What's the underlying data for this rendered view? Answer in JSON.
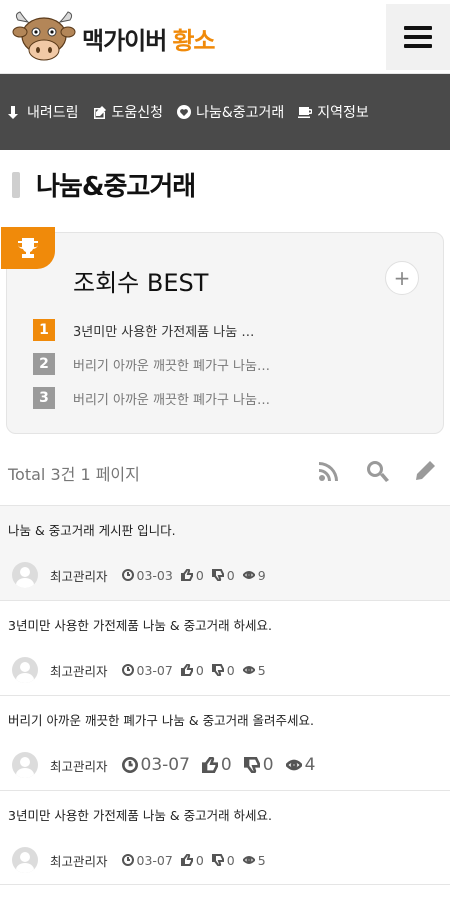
{
  "header": {
    "brand_dark": "맥가이버",
    "brand_orange": "황소"
  },
  "nav": {
    "items": [
      {
        "label": "내려드림",
        "icon": "download-arrow-icon"
      },
      {
        "label": "도움신청",
        "icon": "edit-icon"
      },
      {
        "label": "나눔&중고거래",
        "icon": "heart-icon"
      },
      {
        "label": "지역정보",
        "icon": "coffee-icon"
      }
    ]
  },
  "page": {
    "title": "나눔&중고거래"
  },
  "best": {
    "title": "조회수 BEST",
    "plus": "+",
    "items": [
      {
        "rank": "1",
        "text": "3년미만 사용한 가전제품 나눔 …"
      },
      {
        "rank": "2",
        "text": "버리기 아까운 깨끗한 폐가구 나눔…"
      },
      {
        "rank": "3",
        "text": "버리기 아까운 깨끗한 폐가구 나눔…"
      }
    ]
  },
  "toolbar": {
    "total": "Total 3건 1 페이지"
  },
  "posts": [
    {
      "title": "나눔 & 중고거래 게시판 입니다.",
      "author": "최고관리자",
      "date": "03-03",
      "likes": "0",
      "dislikes": "0",
      "views": "9"
    },
    {
      "title": "3년미만 사용한 가전제품 나눔 & 중고거래 하세요.",
      "author": "최고관리자",
      "date": "03-07",
      "likes": "0",
      "dislikes": "0",
      "views": "5"
    },
    {
      "title": "버리기 아까운 깨끗한 폐가구 나눔 & 중고거래 올려주세요.",
      "author": "최고관리자",
      "date": "03-07",
      "likes": "0",
      "dislikes": "0",
      "views": "4"
    },
    {
      "title": "3년미만 사용한 가전제품 나눔 & 중고거래 하세요.",
      "author": "최고관리자",
      "date": "03-07",
      "likes": "0",
      "dislikes": "0",
      "views": "5"
    }
  ],
  "colors": {
    "accent": "#f08a0a",
    "navbar": "#4a4a4a"
  }
}
